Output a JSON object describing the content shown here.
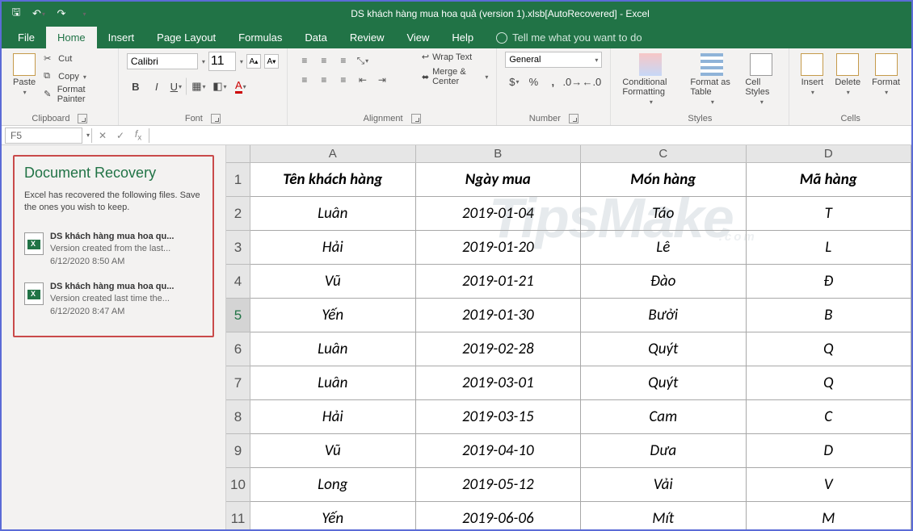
{
  "titlebar": {
    "title": "DS khách hàng mua hoa quả (version 1).xlsb[AutoRecovered]  -  Excel"
  },
  "menubar": {
    "tabs": [
      "File",
      "Home",
      "Insert",
      "Page Layout",
      "Formulas",
      "Data",
      "Review",
      "View",
      "Help"
    ],
    "active": "Home",
    "tellme": "Tell me what you want to do"
  },
  "ribbon": {
    "clipboard": {
      "label": "Clipboard",
      "paste": "Paste",
      "cut": "Cut",
      "copy": "Copy",
      "painter": "Format Painter"
    },
    "font": {
      "label": "Font",
      "name": "Calibri",
      "size": "11"
    },
    "alignment": {
      "label": "Alignment",
      "wrap": "Wrap Text",
      "merge": "Merge & Center"
    },
    "number": {
      "label": "Number",
      "format": "General"
    },
    "styles": {
      "label": "Styles",
      "cond": "Conditional Formatting",
      "table": "Format as Table",
      "cell": "Cell Styles"
    },
    "cells": {
      "label": "Cells",
      "insert": "Insert",
      "delete": "Delete",
      "format": "Format"
    }
  },
  "formulabar": {
    "name": "F5"
  },
  "recovery": {
    "title": "Document Recovery",
    "desc": "Excel has recovered the following files.  Save the ones you wish to keep.",
    "items": [
      {
        "name": "DS khách hàng mua hoa qu...",
        "ver": "Version created from the last...",
        "time": "6/12/2020 8:50 AM"
      },
      {
        "name": "DS khách hàng mua hoa qu...",
        "ver": "Version created last time the...",
        "time": "6/12/2020 8:47 AM"
      }
    ]
  },
  "grid": {
    "cols": [
      "A",
      "B",
      "C",
      "D"
    ],
    "active_cell": "F5",
    "active_row": 5,
    "rows": [
      [
        "Tên khách hàng",
        "Ngày mua",
        "Món hàng",
        "Mã hàng"
      ],
      [
        "Luân",
        "2019-01-04",
        "Táo",
        "T"
      ],
      [
        "Hải",
        "2019-01-20",
        "Lê",
        "L"
      ],
      [
        "Vũ",
        "2019-01-21",
        "Đào",
        "Đ"
      ],
      [
        "Yến",
        "2019-01-30",
        "Bưởi",
        "B"
      ],
      [
        "Luân",
        "2019-02-28",
        "Quýt",
        "Q"
      ],
      [
        "Luân",
        "2019-03-01",
        "Quýt",
        "Q"
      ],
      [
        "Hải",
        "2019-03-15",
        "Cam",
        "C"
      ],
      [
        "Vũ",
        "2019-04-10",
        "Dưa",
        "D"
      ],
      [
        "Long",
        "2019-05-12",
        "Vải",
        "V"
      ],
      [
        "Yến",
        "2019-06-06",
        "Mít",
        "M"
      ]
    ]
  },
  "watermark": "TipsMake"
}
